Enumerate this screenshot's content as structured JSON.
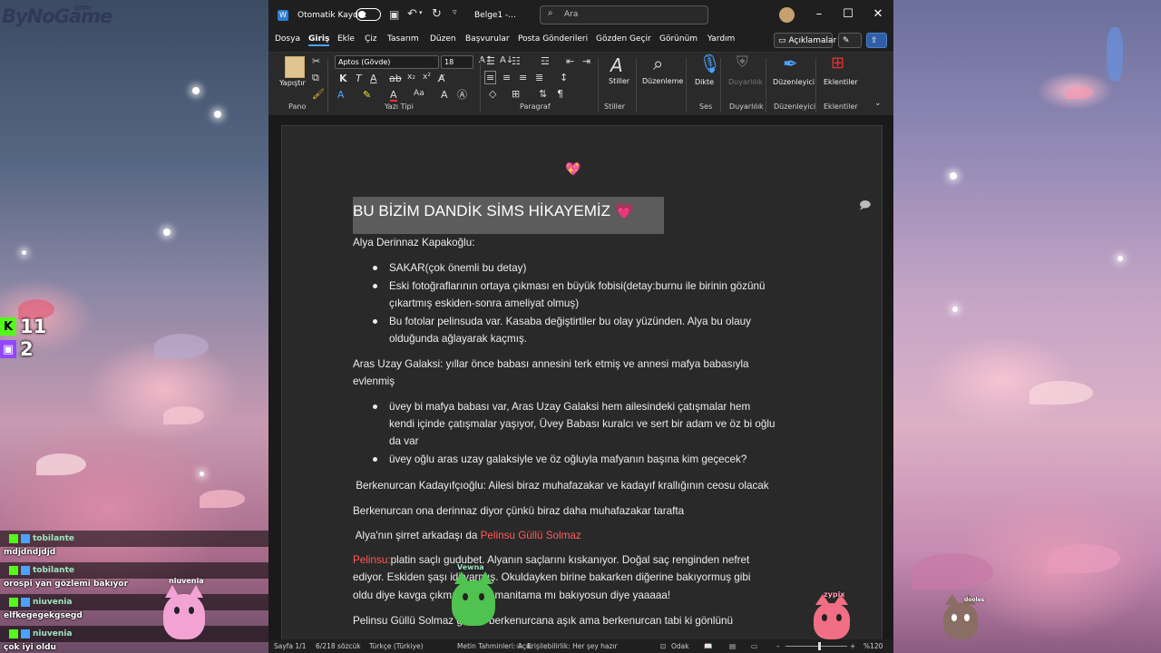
{
  "stream": {
    "logo": "ByNoGame",
    "logo_suffix": "com",
    "kick_count": "11",
    "twitch_count": "2",
    "chat": [
      {
        "name": "tobilante",
        "message": "mdjdndjdjd"
      },
      {
        "name": "tobilante",
        "message": "orospi yan gözlemi bakıyor"
      },
      {
        "name": "niuvenia",
        "message": "elfkegegekgsegd"
      },
      {
        "name": "niuvenia",
        "message": "çok iyi oldu"
      }
    ],
    "mascots": [
      {
        "label": "niuvenia"
      },
      {
        "label": "Vewna"
      },
      {
        "label": "zypix"
      },
      {
        "label": "dooles"
      }
    ]
  },
  "word": {
    "autosave_label": "Otomatik Kaydet",
    "doc_title": "Belge1 -...",
    "search_placeholder": "Ara",
    "menu": [
      "Dosya",
      "Giriş",
      "Ekle",
      "Çiz",
      "Tasarım",
      "Düzen",
      "Başvurular",
      "Posta Gönderileri",
      "Gözden Geçir",
      "Görünüm",
      "Yardım"
    ],
    "active_menu": "Giriş",
    "comments_button": "Açıklamalar",
    "ribbon": {
      "paste": "Yapıştır",
      "font_name": "Aptos (Gövde)",
      "font_size": "18",
      "styles": "Stiller",
      "editing": "Düzenleme",
      "dictate": "Dikte",
      "sensitivity": "Duyarlılık",
      "editor": "Düzenleyici",
      "addins": "Eklentiler",
      "groups": [
        "Pano",
        "Yazı Tipi",
        "Paragraf",
        "Stiller",
        "Ses",
        "Duyarlılık",
        "Düzenleyici",
        "Eklentiler"
      ]
    },
    "document": {
      "heading": "BU BİZİM DANDİK SİMS HİKAYEMİZ",
      "heading_emoji": "💗",
      "para1": "Alya Derinnaz Kapakoğlu:",
      "bullets1": [
        "SAKAR(çok önemli bu detay)",
        "Eski fotoğraflarının ortaya çıkması en büyük fobisi(detay:burnu ile birinin gözünü",
        "çıkartmış eskiden-sonra ameliyat olmuş)",
        "Bu fotolar pelinsuda var. Kasaba değiştirtiler bu olay yüzünden. Alya bu olauy",
        "olduğunda ağlayarak kaçmış."
      ],
      "para2_line1": "Aras Uzay Galaksi: yıllar önce babası annesini terk etmiş ve annesi mafya babasıyla",
      "para2_line2": "evlenmiş",
      "bullets2": [
        "üvey bi mafya babası var, Aras Uzay Galaksi hem ailesindeki çatışmalar hem",
        "kendi içinde çatışmalar yaşıyor, Üvey Babası kuralcı ve sert bir adam ve öz bi oğlu",
        "da var",
        "üvey oğlu aras uzay galaksiyle ve öz oğluyla mafyanın başına kim geçecek?"
      ],
      "para3": " Berkenurcan Kadayıfçıoğlu: Ailesi biraz muhafazakar ve kadayıf krallığının ceosu olacak",
      "para4": "Berkenurcan ona derinnaz diyor çünkü biraz daha muhafazakar tarafta",
      "para5_prefix": " Alya'nın şirret arkadaşı da ",
      "para5_red": "Pelinsu Güllü Solmaz",
      "para6_red": "Pelinsu:",
      "para6_line1": "platin saçlı gudubet. Alyanın saçlarını kıskanıyor. Doğal saç renginden nefret",
      "para6_line2": "ediyor. Eskiden şaşı idi varmış. Okuldayken birine bakarken diğerine bakıyormuş gibi",
      "para6_line3": "oldu diye kavga çıkmış benim manitama mı bakıyosun diye yaaaaa!",
      "para7": "Pelinsu Güllü Solmaz gizlice berkenurcana aşık ama berkenurcan tabi ki gönlünü"
    },
    "status": {
      "page": "Sayfa 1/1",
      "words": "6/218 sözcük",
      "language": "Türkçe (Türkiye)",
      "prediction": "Metin Tahminleri: Açık",
      "accessibility": "Erişilebilirlik: Her şey hazır",
      "focus": "Odak",
      "zoom": "%120"
    }
  }
}
